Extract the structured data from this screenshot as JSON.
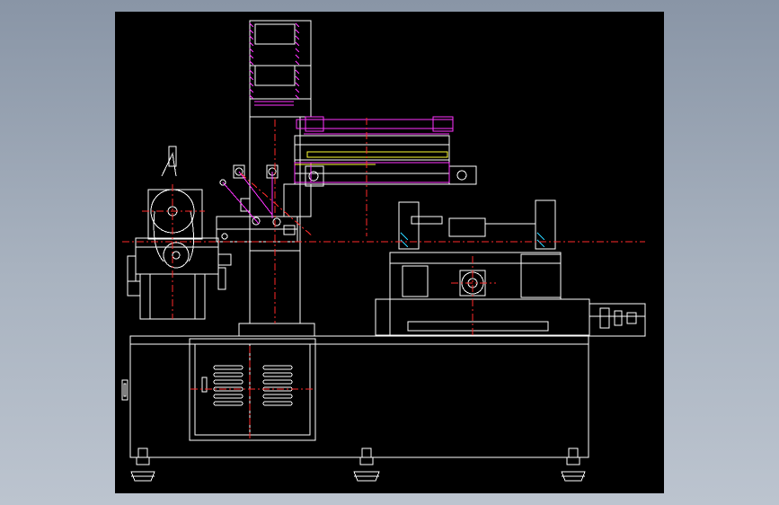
{
  "viewer": {
    "background_top": "#8995a6",
    "background_bottom": "#bcc4cf"
  },
  "drawing": {
    "background": "#000000",
    "line_color": "#ffffff",
    "centerline_color": "#ff2a2a",
    "highlight_color": "#ff33ff",
    "accent_color": "#ffff33",
    "hatch_color": "#2ad4ff"
  }
}
